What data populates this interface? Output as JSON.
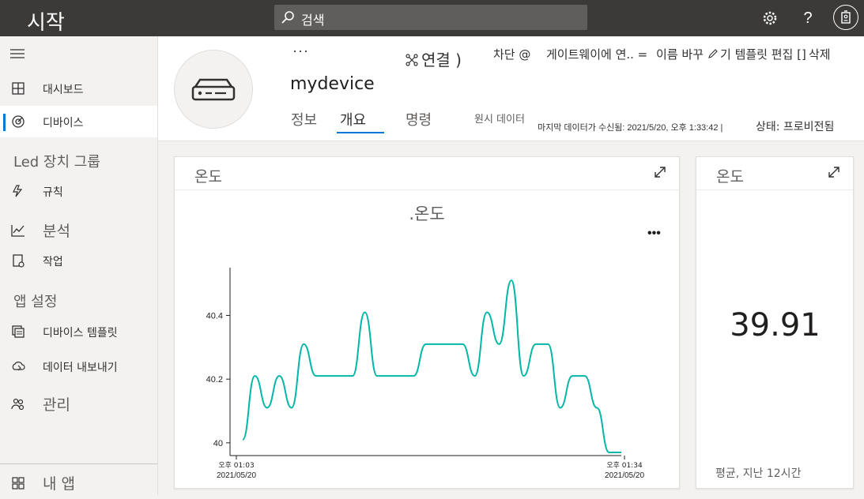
{
  "app": {
    "title": "시작"
  },
  "search": {
    "label": "검색"
  },
  "topbar": {
    "settings_icon": "gear-icon",
    "help_label": "?",
    "avatar_icon": "badge-icon"
  },
  "sidebar": {
    "items": [
      {
        "label": "대시보드",
        "icon": "dashboard-icon"
      },
      {
        "label": "디바이스",
        "icon": "devices-icon",
        "active": true
      },
      {
        "label": "규칙",
        "icon": "rules-icon"
      },
      {
        "label": "분석",
        "icon": "analytics-icon"
      },
      {
        "label": "작업",
        "icon": "jobs-icon"
      },
      {
        "label": "디바이스 템플릿",
        "icon": "device-template-icon"
      },
      {
        "label": "데이터 내보내기",
        "icon": "data-export-icon"
      },
      {
        "label": "관리",
        "icon": "administration-icon"
      },
      {
        "label": "내 앱",
        "icon": "my-apps-icon"
      }
    ],
    "groups": [
      {
        "label": "Led 장치 그룹"
      },
      {
        "label": "앱 설정"
      }
    ]
  },
  "header": {
    "more": "···",
    "device_name": "mydevice",
    "commands": {
      "connect": "연결 )",
      "block": "차단 @",
      "gateway": "게이트웨이에 연.. =",
      "rename": "이름 바꾸",
      "edit_template": "기 템플릿 편집 []",
      "delete": "삭제"
    },
    "tabs": [
      {
        "label": "정보"
      },
      {
        "label": "개요",
        "active": true
      },
      {
        "label": "명령"
      },
      {
        "label": "원시 데이터"
      }
    ],
    "last_data": "마지막 데이터가 수신됨: 2021/5/20, 오후 1:33:42 |",
    "status": "상태: 프로비전됨"
  },
  "chart_card": {
    "title": "온도",
    "chart_title": ".온도",
    "more": "•••"
  },
  "chart_data": {
    "type": "line",
    "title": ".온도",
    "xlabel": "",
    "ylabel": "",
    "ylim": [
      39.96,
      40.55
    ],
    "yticks": [
      40,
      40.2,
      40.4
    ],
    "ytick_labels": [
      "40",
      "40.2",
      "40.4"
    ],
    "xtick_labels": [
      {
        "time": "오후 01:03",
        "date": "2021/05/20"
      },
      {
        "time": "오후 01:34",
        "date": "2021/05/20"
      }
    ],
    "series": [
      {
        "color": "#00b7a8",
        "x": [
          0,
          1,
          2,
          3,
          4,
          5,
          6,
          7,
          8,
          9,
          10,
          11,
          12,
          13,
          14,
          15,
          16,
          17,
          18,
          19,
          20,
          21,
          22,
          23,
          24,
          25,
          26,
          27,
          28,
          29,
          30,
          31
        ],
        "values": [
          40.01,
          40.21,
          40.11,
          40.21,
          40.11,
          40.31,
          40.21,
          40.21,
          40.21,
          40.21,
          40.41,
          40.21,
          40.21,
          40.21,
          40.21,
          40.31,
          40.31,
          40.31,
          40.31,
          40.21,
          40.41,
          40.31,
          40.51,
          40.21,
          40.31,
          40.31,
          40.11,
          40.21,
          40.21,
          40.11,
          39.97,
          39.97
        ]
      }
    ]
  },
  "kpi_card": {
    "title": "온도",
    "value": "39.91",
    "caption": "평균, 지난 12시간"
  }
}
